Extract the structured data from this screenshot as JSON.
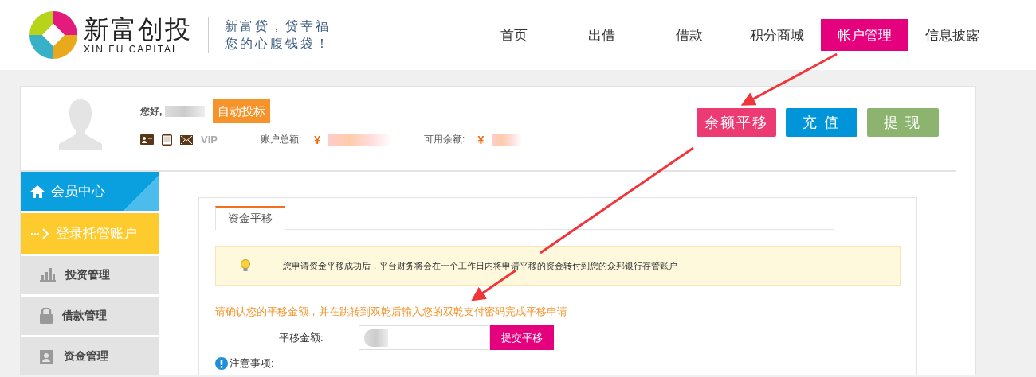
{
  "logo": {
    "name": "新富创投",
    "subtitle": "XIN FU CAPITAL",
    "slogan_lines": [
      "新富贷，贷幸福",
      "您的心腹钱袋！"
    ]
  },
  "nav": [
    {
      "label": "首页",
      "selected": false
    },
    {
      "label": "出借",
      "selected": false
    },
    {
      "label": "借款",
      "selected": false
    },
    {
      "label": "积分商城",
      "selected": false
    },
    {
      "label": "帐户管理",
      "selected": true
    },
    {
      "label": "信息披露",
      "selected": false
    }
  ],
  "account": {
    "greeting": "您好,",
    "auto_bid_button": "自动投标",
    "vip": "VIP",
    "total_label": "账户总额:",
    "total_currency": "¥",
    "available_label": "可用余额:",
    "available_currency": "¥"
  },
  "actions": [
    {
      "label": "余额平移",
      "color": "#ec3a73"
    },
    {
      "label": "充 值",
      "color": "#0095d8"
    },
    {
      "label": "提 现",
      "color": "#8cb46e"
    }
  ],
  "sidebar": [
    {
      "label": "会员中心",
      "kind": "header"
    },
    {
      "label": "登录托管账户",
      "kind": "highlight"
    },
    {
      "label": "投资管理",
      "kind": "chart"
    },
    {
      "label": "借款管理",
      "kind": "lock"
    },
    {
      "label": "资金管理",
      "kind": "contact"
    }
  ],
  "tabs": [
    {
      "label": "资金平移",
      "selected": true
    }
  ],
  "notice": "您申请资金平移成功后，平台财务将会在一个工作日内将申请平移的资金转付到您的众邦银行存管账户",
  "instruction": "请确认您的平移金额，并在跳转到双乾后输入您的双乾支付密码完成平移申请",
  "amount_label": "平移金额:",
  "submit_button": "提交平移",
  "notes_title": "注意事项:"
}
